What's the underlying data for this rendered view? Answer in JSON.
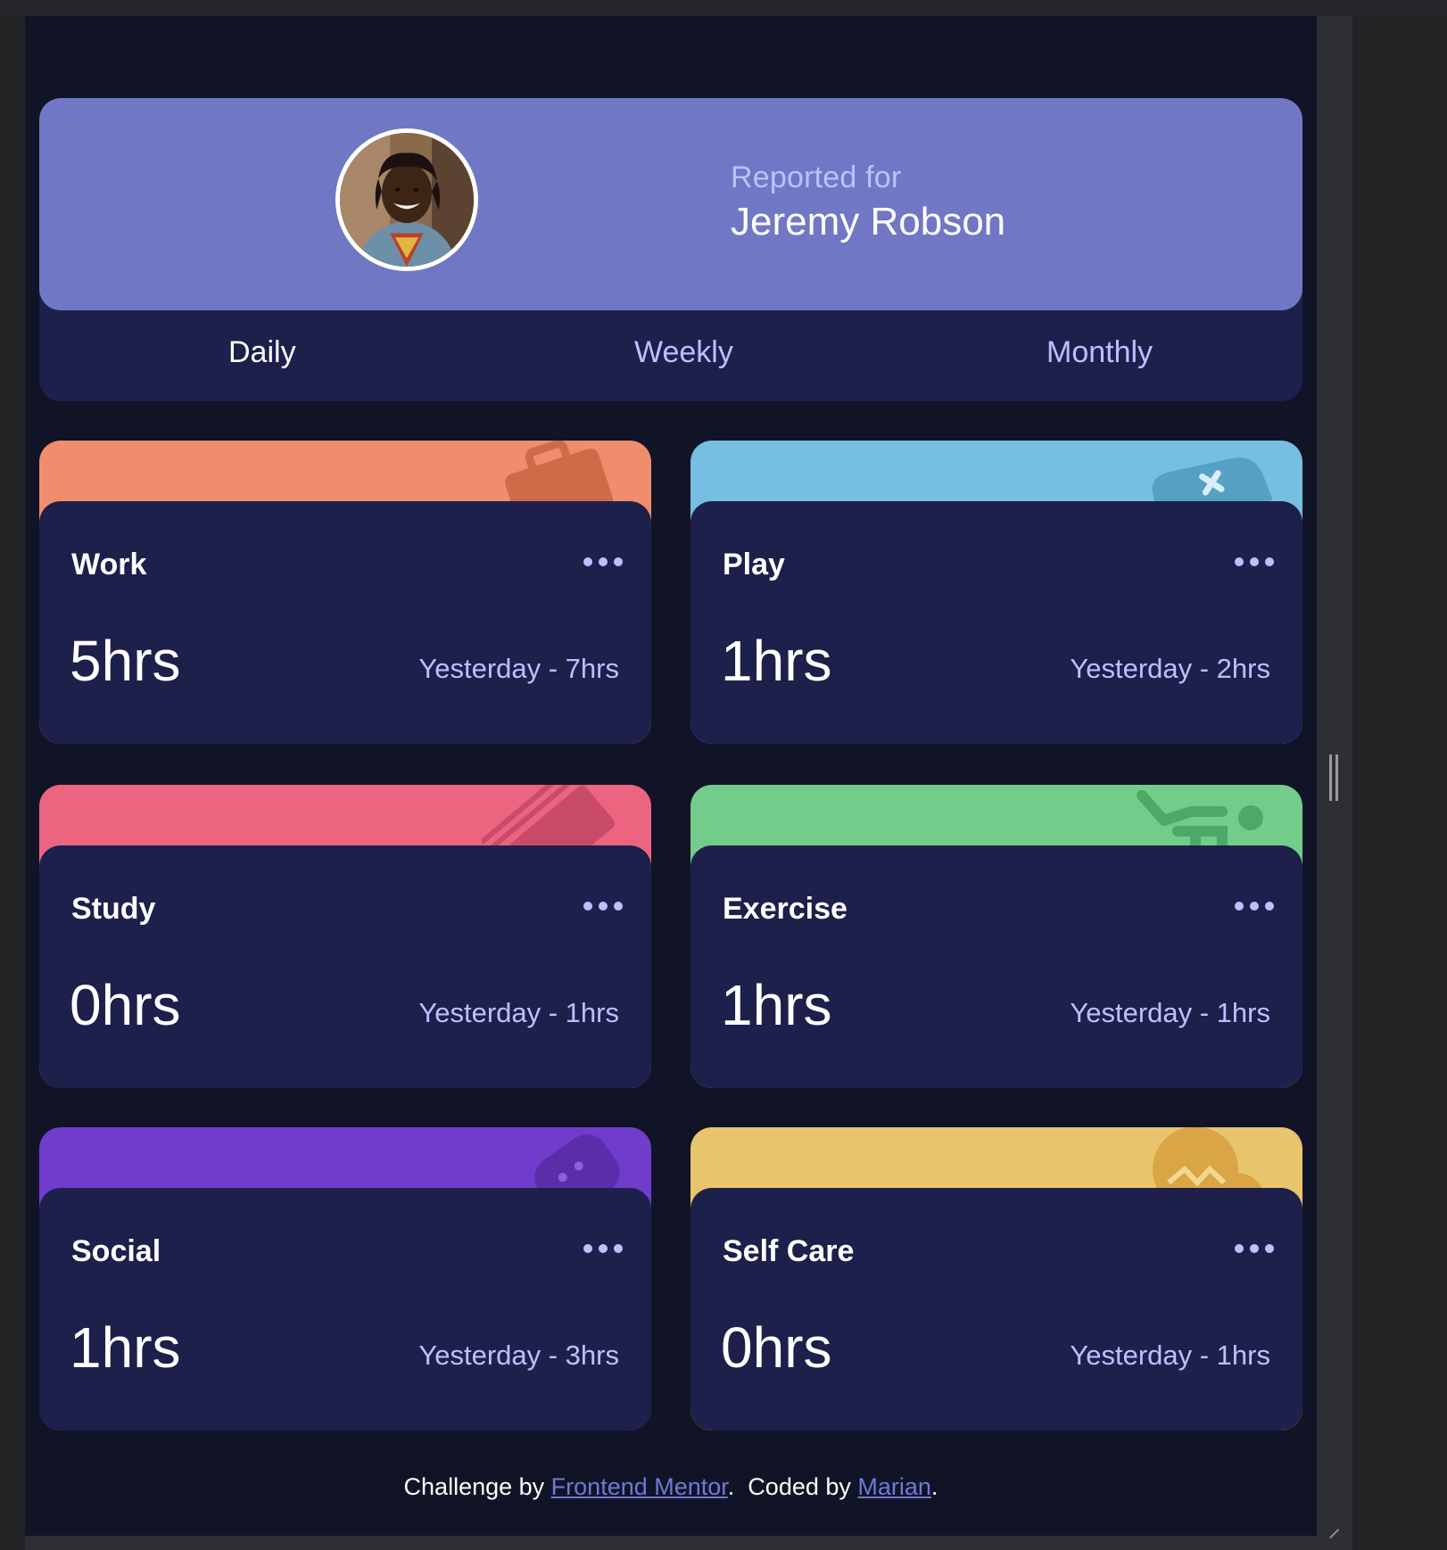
{
  "profile": {
    "reported_label": "Reported for",
    "name": "Jeremy Robson"
  },
  "tabs": [
    {
      "label": "Daily",
      "active": true
    },
    {
      "label": "Weekly",
      "active": false
    },
    {
      "label": "Monthly",
      "active": false
    }
  ],
  "cards": [
    {
      "title": "Work",
      "current": "5hrs",
      "previous": "Yesterday - 7hrs",
      "color": "#f08d6c",
      "icon": "briefcase-icon"
    },
    {
      "title": "Play",
      "current": "1hrs",
      "previous": "Yesterday - 2hrs",
      "color": "#76bee2",
      "icon": "gamepad-icon"
    },
    {
      "title": "Study",
      "current": "0hrs",
      "previous": "Yesterday - 1hrs",
      "color": "#eb6581",
      "icon": "book-icon"
    },
    {
      "title": "Exercise",
      "current": "1hrs",
      "previous": "Yesterday - 1hrs",
      "color": "#74cc8a",
      "icon": "runner-icon"
    },
    {
      "title": "Social",
      "current": "1hrs",
      "previous": "Yesterday - 3hrs",
      "color": "#703ccc",
      "icon": "chat-icon"
    },
    {
      "title": "Self Care",
      "current": "0hrs",
      "previous": "Yesterday - 1hrs",
      "color": "#e8c56c",
      "icon": "heart-icon"
    }
  ],
  "footer": {
    "prefix": "Challenge by ",
    "challenge_link": "Frontend Mentor",
    "middle": ".  Coded by ",
    "author_link": "Marian",
    "suffix": "."
  },
  "colors": {
    "background": "#111426",
    "card": "#1d204b",
    "profile": "#7078c5",
    "muted_text": "#bbc0ff"
  }
}
